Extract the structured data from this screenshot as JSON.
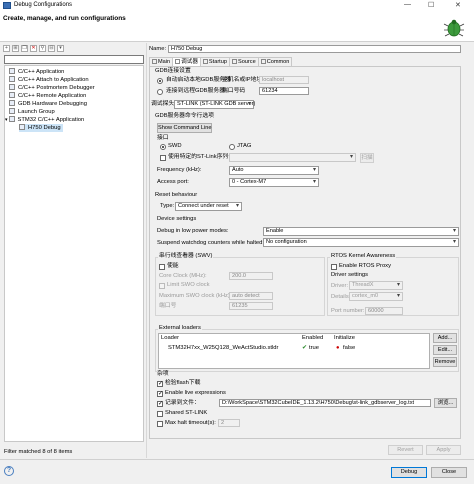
{
  "window": {
    "title": "Debug Configurations",
    "min": "—",
    "max": "☐",
    "close": "✕"
  },
  "header": {
    "heading": "Create, manage, and run configurations"
  },
  "sidebar": {
    "toolbar_icons": [
      "new-config-icon",
      "new-prototype-icon",
      "duplicate-icon",
      "delete-icon",
      "filter-icon",
      "collapse-all-icon",
      "view-menu-icon"
    ],
    "filter_placeholder": "",
    "items": [
      {
        "label": "C/C++ Application",
        "level": 0
      },
      {
        "label": "C/C++ Attach to Application",
        "level": 0
      },
      {
        "label": "C/C++ Postmortem Debugger",
        "level": 0
      },
      {
        "label": "C/C++ Remote Application",
        "level": 0
      },
      {
        "label": "GDB Hardware Debugging",
        "level": 0
      },
      {
        "label": "Launch Group",
        "level": 0
      },
      {
        "label": "STM32 C/C++ Application",
        "level": 0,
        "expanded": true
      },
      {
        "label": "H750 Debug",
        "level": 1,
        "selected": true
      }
    ],
    "status": "Filter matched 8 of 8 items"
  },
  "main": {
    "name_label": "Name:",
    "name_value": "H750 Debug",
    "tabs": [
      "Main",
      "调试器",
      "Startup",
      "Source",
      "Common"
    ],
    "gdb": {
      "group_title": "GDB连接设置",
      "auto_radio": "自动启动本地GDB服务器",
      "host_label": "主机名或IP地址",
      "host_value": "localhost",
      "remote_radio": "连接到远程GDB服务器",
      "port_label": "端口号码",
      "port_value": "61234"
    },
    "probe": {
      "label": "调试探头",
      "value": "ST-LINK (ST-LINK GDB server)"
    },
    "server": {
      "group_title": "GDB服务器命令行选项",
      "show_cmd_button": "Show Command Line",
      "interface_title": "接口",
      "swd": "SWD",
      "jtag": "JTAG",
      "specific_stlink": "使用特定的ST-Link序列号",
      "scan_button": "扫描",
      "frequency_label": "Frequency (kHz):",
      "frequency_value": "Auto",
      "access_port_label": "Access port:",
      "access_port_value": "0 - Cortex-M7"
    },
    "reset": {
      "group_title": "Reset behaviour",
      "type_label": "Type:",
      "type_value": "Connect under reset"
    },
    "device": {
      "group_title": "Device settings",
      "low_power_label": "Debug in low power modes:",
      "low_power_value": "Enable",
      "watchdog_label": "Suspend watchdog counters while halted:",
      "watchdog_value": "No configuration"
    },
    "swv": {
      "group_title": "串行线查看器 (SWV)",
      "enable": "使能",
      "core_clock_label": "Core Clock (MHz):",
      "core_clock_value": "200.0",
      "limit_swo": "Limit SWO clock",
      "max_swo_label": "Maximum SWO clock (kHz):",
      "max_swo_value": "auto detect",
      "port_label": "端口号",
      "port_value": "61235"
    },
    "rtos": {
      "group_title": "RTOS Kernel Awareness",
      "enable": "Enable RTOS Proxy",
      "driver_title": "Driver settings",
      "driver_label": "Driver:",
      "driver_value": "ThreadX",
      "details_label": "Details:",
      "details_value": "cortex_m0",
      "port_label": "Port number:",
      "port_value": "60000"
    },
    "loaders": {
      "group_title": "External loaders",
      "columns": [
        "Loader",
        "Enabled",
        "Initialize"
      ],
      "rows": [
        {
          "loader": "STM32H7xx_W25Q128_WeActStudio.stldr",
          "enabled": "true",
          "initialize": "false"
        }
      ],
      "add": "Add...",
      "edit": "Edit...",
      "remove": "Remove"
    },
    "misc": {
      "group_title": "杂项",
      "verify_flash": "检验flash下载",
      "live_expr": "Enable live expressions",
      "log_file_label": "记录到文件：",
      "log_file_value": "D:\\WorkSpace\\STM32CubeIDE_1.13.2\\H750\\Debug\\st-link_gdbserver_log.txt",
      "browse": "浏览...",
      "shared": "Shared ST-LINK",
      "max_halt_label": "Max halt timeout(s):",
      "max_halt_value": "2"
    },
    "revert": "Revert",
    "apply": "Apply"
  },
  "footer": {
    "help": "?",
    "debug": "Debug",
    "close": "Close"
  }
}
